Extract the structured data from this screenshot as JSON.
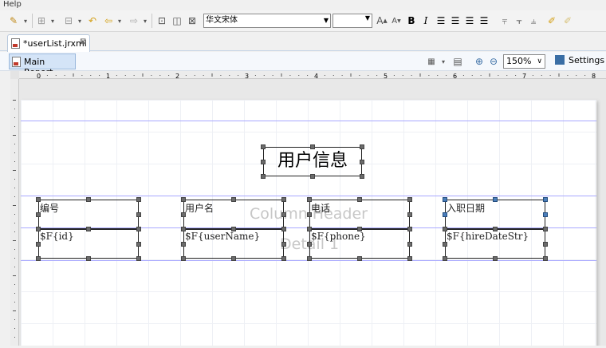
{
  "menu": {
    "help": "Help"
  },
  "toolbar": {
    "font_name": "华文宋体",
    "font_size": "",
    "icons": [
      "wrench-icon",
      "align-icon",
      "size-icon",
      "undo-icon",
      "back-icon",
      "forward-icon",
      "layout-icons",
      "grow-font-icon",
      "shrink-font-icon",
      "bold-icon",
      "italic-icon",
      "align-left-icon",
      "align-center-icon",
      "align-right-icon",
      "justify-icon"
    ],
    "grow_label": "A",
    "shrink_label": "A",
    "bold_label": "B",
    "italic_label": "I"
  },
  "editor_tab": {
    "label": "*userList.jrxml",
    "close": "⊠"
  },
  "report_bar": {
    "main_report": "Main Report",
    "zoom": "150%",
    "settings": "Settings"
  },
  "ruler": {
    "h_numbers": [
      "0",
      "1",
      "2",
      "3",
      "4",
      "5",
      "6",
      "7",
      "8"
    ]
  },
  "report": {
    "title_text": "用户信息",
    "column_header_band": "Column Header",
    "detail_band": "Detail 1",
    "headers": [
      "编号",
      "用户名",
      "电话",
      "入职日期"
    ],
    "fields": [
      "$F{id}",
      "$F{userName}",
      "$F{phone}",
      "$F{hireDateStr}"
    ]
  },
  "colors": {
    "band_line": "#a9a9ff",
    "selected_handle": "#4a7ebb",
    "handle": "#6b6b6b"
  }
}
